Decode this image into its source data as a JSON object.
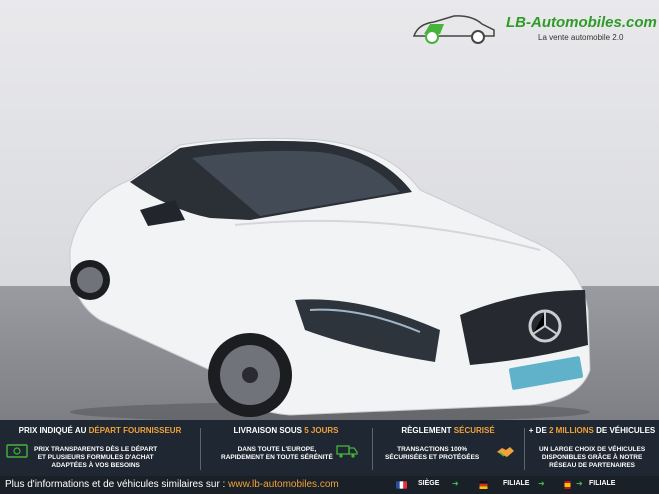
{
  "logo": {
    "name": "LB-Automobiles.com",
    "tagline": "La vente automobile 2.0",
    "icon": "car-logo-icon"
  },
  "features": [
    {
      "title_prefix": "PRIX INDIQUÉ AU ",
      "title_accent": "DÉPART FOURNISSEUR",
      "desc": [
        "PRIX TRANSPARENTS DÈS LE DÉPART",
        "ET PLUSIEURS FORMULES D'ACHAT",
        "ADAPTÉES À VOS BESOINS"
      ],
      "icon": "cash-icon"
    },
    {
      "title_prefix": "LIVRAISON SOUS ",
      "title_accent": "5 JOURS",
      "desc": [
        "DANS TOUTE L'EUROPE,",
        "RAPIDEMENT EN TOUTE SÉRÉNITÉ"
      ],
      "icon": "truck-icon"
    },
    {
      "title_prefix": "RÈGLEMENT ",
      "title_accent": "SÉCURISÉ",
      "desc": [
        "TRANSACTIONS 100%",
        "SÉCURISÉES ET PROTÉGÉES"
      ],
      "icon": "handshake-icon"
    },
    {
      "title_prefix": "+ DE ",
      "title_accent": "2 MILLIONS",
      "title_suffix": " DE VÉHICULES",
      "desc": [
        "UN LARGE CHOIX DE VÉHICULES",
        "DISPONIBLES GRÂCE À NOTRE",
        "RÉSEAU DE PARTENAIRES"
      ]
    }
  ],
  "footer": {
    "text": "Plus d'informations et de véhicules similaires sur : ",
    "link": "www.lb-automobiles.com",
    "locations": [
      "SIÈGE",
      "FILIALE",
      "FILIALE"
    ],
    "colors": {
      "accent": "#f0a23a",
      "band": "#1f2732"
    }
  }
}
